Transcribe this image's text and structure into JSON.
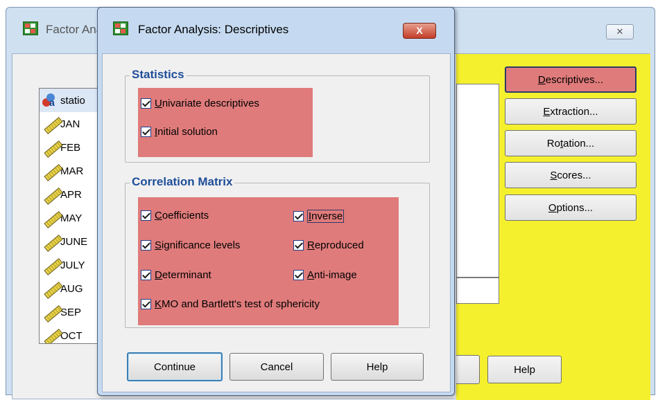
{
  "parent_window": {
    "title": "Factor Analysis",
    "close_label": "✕",
    "variables": [
      {
        "label": "statio",
        "icon": "string-variable-icon"
      },
      {
        "label": "JAN",
        "icon": "ruler-icon"
      },
      {
        "label": "FEB",
        "icon": "ruler-icon"
      },
      {
        "label": "MAR",
        "icon": "ruler-icon"
      },
      {
        "label": "APR",
        "icon": "ruler-icon"
      },
      {
        "label": "MAY",
        "icon": "ruler-icon"
      },
      {
        "label": "JUNE",
        "icon": "ruler-icon"
      },
      {
        "label": "JULY",
        "icon": "ruler-icon"
      },
      {
        "label": "AUG",
        "icon": "ruler-icon"
      },
      {
        "label": "SEP",
        "icon": "ruler-icon"
      },
      {
        "label": "OCT",
        "icon": "ruler-icon"
      }
    ],
    "buttons": {
      "descriptives": {
        "pre": "",
        "u": "D",
        "post": "escriptives..."
      },
      "extraction": {
        "pre": "",
        "u": "E",
        "post": "xtraction..."
      },
      "rotation": {
        "pre": "Ro",
        "u": "t",
        "post": "ation..."
      },
      "scores": {
        "pre": "",
        "u": "S",
        "post": "cores..."
      },
      "options": {
        "pre": "",
        "u": "O",
        "post": "ptions..."
      },
      "help": "Help"
    }
  },
  "dialog": {
    "title": "Factor Analysis: Descriptives",
    "close_label": "X",
    "statistics": {
      "legend": "Statistics",
      "univariate": {
        "u": "U",
        "post": "nivariate descriptives",
        "checked": true
      },
      "initial": {
        "u": "I",
        "post": "nitial solution",
        "checked": true
      }
    },
    "correlation_matrix": {
      "legend": "Correlation Matrix",
      "coefficients": {
        "u": "C",
        "post": "oefficients",
        "checked": true
      },
      "inverse": {
        "u": "I",
        "post": "nverse",
        "checked": true
      },
      "significance": {
        "u": "S",
        "post": "ignificance levels",
        "checked": true
      },
      "reproduced": {
        "u": "R",
        "post": "eproduced",
        "checked": true
      },
      "determinant": {
        "u": "D",
        "post": "eterminant",
        "checked": true
      },
      "anti_image": {
        "u": "A",
        "post": "nti-image",
        "checked": true
      },
      "kmo": {
        "u": "K",
        "post": "MO and Bartlett's test of sphericity",
        "checked": true
      }
    },
    "buttons": {
      "continue": "Continue",
      "cancel": "Cancel",
      "help": "Help"
    }
  },
  "colors": {
    "highlight_red": "#e07b7b",
    "yellow_panel": "#f5f02d",
    "legend_blue": "#1f4e99"
  }
}
